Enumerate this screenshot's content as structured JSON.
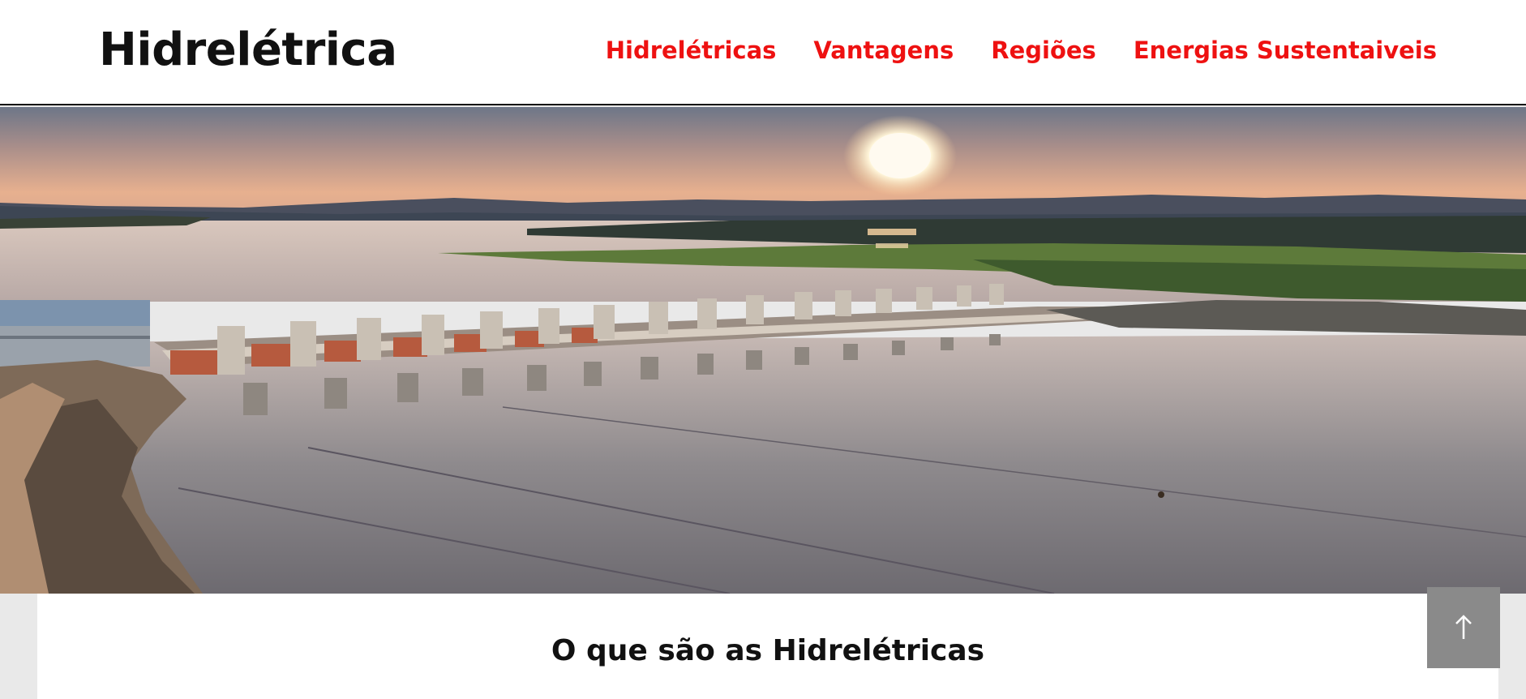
{
  "header": {
    "brand": "Hidrelétrica",
    "nav": [
      {
        "label": "Hidrelétricas"
      },
      {
        "label": "Vantagens"
      },
      {
        "label": "Regiões"
      },
      {
        "label": "Energias Sustentaiveis"
      }
    ]
  },
  "colors": {
    "nav_link": "#ee1111",
    "header_border": "#111111",
    "page_bg": "#e9e9e9",
    "back_to_top_bg": "#8a8a8a"
  },
  "main": {
    "section_title": "O que são as Hidrelétricas"
  },
  "icons": {
    "back_to_top": "arrow-up-icon"
  }
}
